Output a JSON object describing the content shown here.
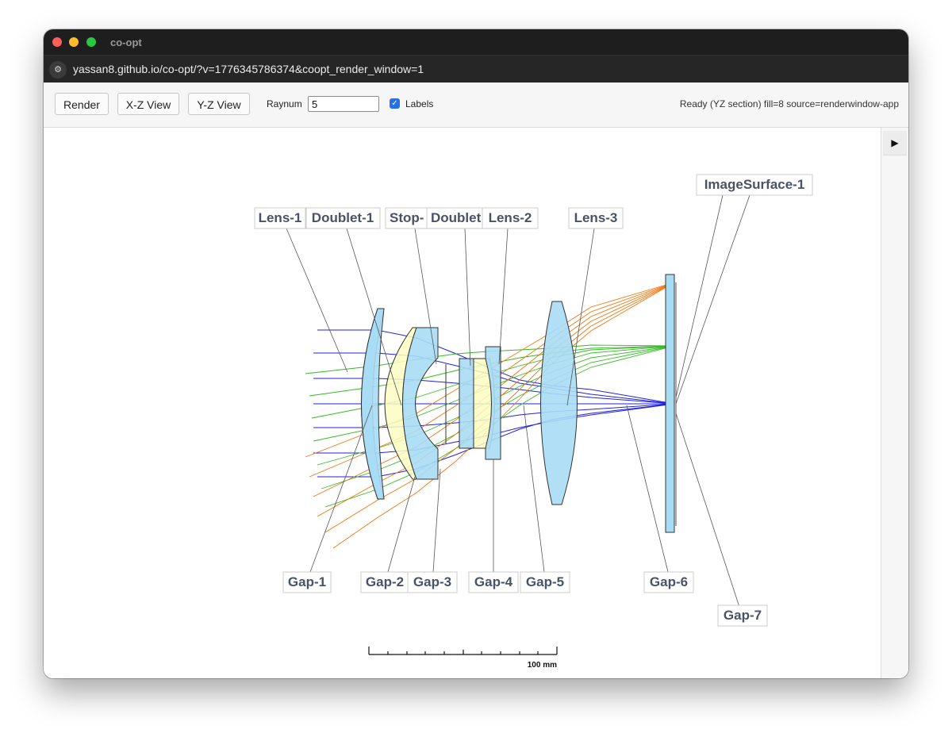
{
  "window": {
    "title": "co-opt",
    "url": "yassan8.github.io/co-opt/?v=1776345786374&coopt_render_window=1",
    "site_icon": "site-settings-icon"
  },
  "toolbar": {
    "render_label": "Render",
    "xz_label": "X-Z View",
    "yz_label": "Y-Z View",
    "raynum_label": "Raynum",
    "raynum_value": "5",
    "labels_label": "Labels",
    "labels_checked": true,
    "status": "Ready (YZ section) fill=8 source=renderwindow-app"
  },
  "sidepanel": {
    "toggle_icon": "play-triangle-icon"
  },
  "diagram": {
    "top_labels": [
      "Lens-1",
      "Doublet-1",
      "Stop-",
      "Doublet",
      "Lens-2",
      "Lens-3",
      "ImageSurface-1"
    ],
    "bottom_labels": [
      "Gap-1",
      "Gap-2",
      "Gap-3",
      "Gap-4",
      "Gap-5",
      "Gap-6",
      "Gap-7"
    ],
    "scale_label": "100 mm",
    "colors": {
      "lens": "#a8dcf5",
      "doublet": "#fbfdc2",
      "ray_blue": "#2222dd",
      "ray_green": "#33bb22",
      "ray_orange": "#ee7711"
    }
  }
}
